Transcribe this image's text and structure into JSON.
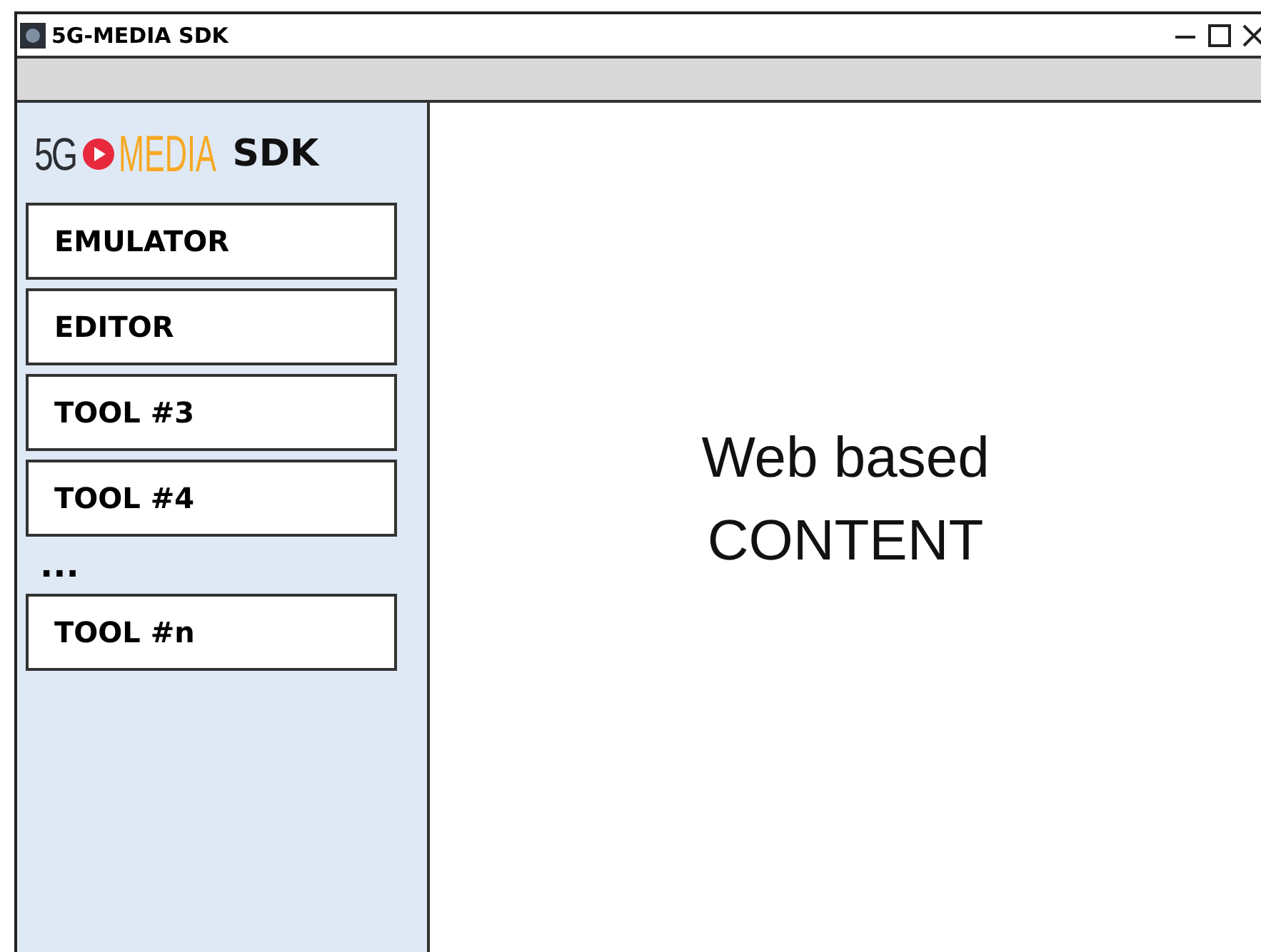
{
  "window": {
    "title": "5G-MEDIA SDK"
  },
  "logo": {
    "part_1": "5G",
    "part_2": "MEDIA",
    "part_3": "SDK"
  },
  "sidebar": {
    "items": [
      {
        "kind": "button",
        "label": "EMULATOR"
      },
      {
        "kind": "button",
        "label": "EDITOR"
      },
      {
        "kind": "button",
        "label": "TOOL #3"
      },
      {
        "kind": "button",
        "label": "TOOL #4"
      },
      {
        "kind": "ellipsis",
        "label": "..."
      },
      {
        "kind": "button",
        "label": "TOOL #n"
      }
    ]
  },
  "content": {
    "lines": [
      "Web based",
      "CONTENT"
    ]
  }
}
